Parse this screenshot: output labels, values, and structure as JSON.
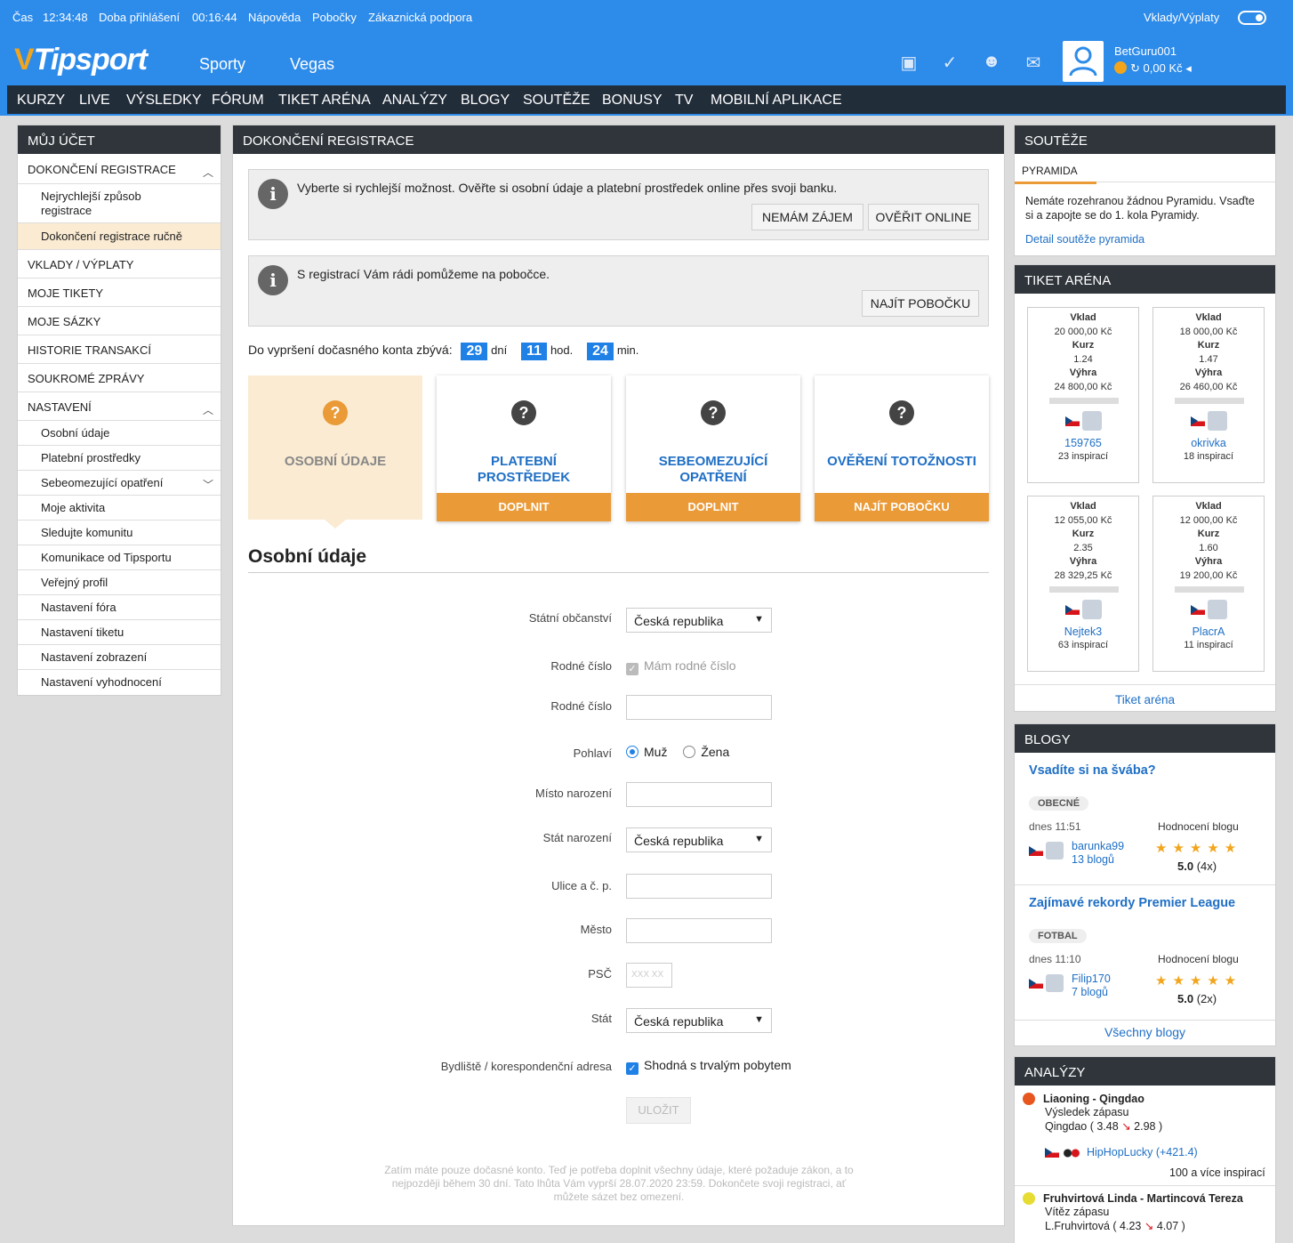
{
  "utility": {
    "time_label": "Čas",
    "time": "12:34:48",
    "login_label": "Doba přihlášení",
    "login_time": "00:16:44",
    "help": "Nápověda",
    "branches": "Pobočky",
    "support": "Zákaznická podpora",
    "deposits": "Vklady/Výplaty"
  },
  "header": {
    "logo": "Tipsport",
    "nav": [
      "Sporty",
      "Vegas"
    ],
    "username": "BetGuru001",
    "balance": "0,00",
    "currency": "Kč"
  },
  "subnav": [
    "KURZY",
    "LIVE",
    "VÝSLEDKY",
    "FÓRUM",
    "TIKET ARÉNA",
    "ANALÝZY",
    "BLOGY",
    "SOUTĚŽE",
    "BONUSY",
    "TV",
    "MOBILNÍ APLIKACE"
  ],
  "sidebar": {
    "title": "MŮJ ÚČET",
    "items": [
      "DOKONČENÍ REGISTRACE",
      "Nejrychlejší způsob registrace",
      "Dokončení registrace ručně",
      "VKLADY / VÝPLATY",
      "MOJE TIKETY",
      "MOJE SÁZKY",
      "HISTORIE TRANSAKCÍ",
      "SOUKROMÉ ZPRÁVY",
      "NASTAVENÍ",
      "Osobní údaje",
      "Platební prostředky",
      "Sebeomezující opatření",
      "Moje aktivita",
      "Sledujte komunitu",
      "Komunikace od Tipsportu",
      "Veřejný profil",
      "Nastavení fóra",
      "Nastavení tiketu",
      "Nastavení zobrazení",
      "Nastavení vyhodnocení"
    ]
  },
  "main": {
    "title": "DOKONČENÍ REGISTRACE",
    "info1": {
      "text": "Vyberte si rychlejší možnost. Ověřte si osobní údaje a platební prostředek online přes svoji banku.",
      "btn_no": "NEMÁM ZÁJEM",
      "btn_yes": "OVĚŘIT ONLINE"
    },
    "info2": {
      "text": "S registrací Vám rádi pomůžeme na pobočce.",
      "btn": "NAJÍT POBOČKU"
    },
    "countdown": {
      "label": "Do vypršení dočasného konta zbývá:",
      "days": "29",
      "days_unit": "dní",
      "hours": "11",
      "hours_unit": "hod.",
      "mins": "24",
      "mins_unit": "min."
    },
    "steps": [
      {
        "icon": "?",
        "label": "OSOBNÍ ÚDAJE",
        "action": ""
      },
      {
        "icon": "?",
        "label": "PLATEBNÍ PROSTŘEDEK",
        "action": "DOPLNIT"
      },
      {
        "icon": "?",
        "label": "SEBEOMEZUJÍCÍ OPATŘENÍ",
        "action": "DOPLNIT"
      },
      {
        "icon": "?",
        "label": "OVĚŘENÍ TOTOŽNOSTI",
        "action": "NAJÍT POBOČKU"
      }
    ],
    "form_title": "Osobní údaje",
    "form": {
      "citizenship_label": "Státní občanství",
      "citizenship": "Česká republika",
      "rc_check_label": "Rodné číslo",
      "rc_check_text": "Mám rodné číslo",
      "rc_label": "Rodné číslo",
      "gender_label": "Pohlaví",
      "male": "Muž",
      "female": "Žena",
      "birthplace_label": "Místo narození",
      "birth_state_label": "Stát narození",
      "birth_state": "Česká republika",
      "street_label": "Ulice a č. p.",
      "city_label": "Město",
      "zip_label": "PSČ",
      "zip_placeholder": "XXX XX",
      "state_label": "Stát",
      "state": "Česká republika",
      "address_label": "Bydliště / korespondenční adresa",
      "address_check": "Shodná s trvalým pobytem",
      "save": "ULOŽIT"
    },
    "footnote": "Zatím máte pouze dočasné konto. Teď je potřeba doplnit všechny údaje, které požaduje zákon, a to nejpozději během 30 dní. Tato lhůta Vám vyprší 28.07.2020 23:59. Dokončete svoji registraci, ať můžete sázet bez omezení."
  },
  "right": {
    "souteze": {
      "title": "SOUTĚŽE",
      "tab": "PYRAMIDA",
      "text": "Nemáte rozehranou žádnou Pyramidu. Vsaďte si a zapojte se do 1. kola Pyramidy.",
      "link": "Detail soutěže pyramida"
    },
    "tiket": {
      "title": "TIKET ARÉNA",
      "labels": {
        "vklad": "Vklad",
        "kurz": "Kurz",
        "vyhra": "Výhra"
      },
      "cards": [
        {
          "vklad": "20 000,00 Kč",
          "kurz": "1.24",
          "vyhra": "24 800,00 Kč",
          "user": "159765",
          "insp": "23 inspirací"
        },
        {
          "vklad": "18 000,00 Kč",
          "kurz": "1.47",
          "vyhra": "26 460,00 Kč",
          "user": "okrivka",
          "insp": "18 inspirací"
        },
        {
          "vklad": "12 055,00 Kč",
          "kurz": "2.35",
          "vyhra": "28 329,25 Kč",
          "user": "Nejtek3",
          "insp": "63 inspirací"
        },
        {
          "vklad": "12 000,00 Kč",
          "kurz": "1.60",
          "vyhra": "19 200,00 Kč",
          "user": "PlacrA",
          "insp": "11 inspirací"
        }
      ],
      "link": "Tiket aréna"
    },
    "blogy": {
      "title": "BLOGY",
      "rating_label": "Hodnocení blogu",
      "posts": [
        {
          "title": "Vsadíte si na švába?",
          "tag": "OBECNÉ",
          "time": "dnes 11:51",
          "author": "barunka99",
          "count": "13 blogů",
          "rating": "5.0",
          "votes": "(4x)",
          "stars": 5
        },
        {
          "title": "Zajímavé rekordy Premier League",
          "tag": "FOTBAL",
          "time": "dnes 11:10",
          "author": "Filip170",
          "count": "7 blogů",
          "rating": "5.0",
          "votes": "(2x)",
          "stars": 5
        }
      ],
      "link": "Všechny blogy"
    },
    "analyzy": {
      "title": "ANALÝZY",
      "items": [
        {
          "match": "Liaoning - Qingdao",
          "type": "Výsledek zápasu",
          "pick": "Qingdao ( 3.48",
          "arrow": "↘",
          "odds": "2.98 )",
          "author": "HipHopLucky (+421.4)",
          "more": "100 a více inspirací"
        },
        {
          "match": "Fruhvirtová Linda - Martincová Tereza",
          "type": "Vítěz zápasu",
          "pick": "L.Fruhvirtová ( 4.23",
          "arrow": "↘",
          "odds": "4.07 )"
        }
      ]
    }
  },
  "colors": {
    "blue": "#2d8bea",
    "dark": "#2f353b",
    "orange": "#ea9a37",
    "link": "#1f6fc5"
  }
}
